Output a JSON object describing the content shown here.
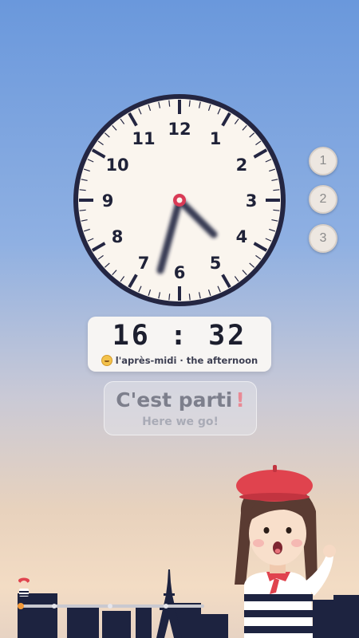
{
  "clock": {
    "numbers": [
      "12",
      "1",
      "2",
      "3",
      "4",
      "5",
      "6",
      "7",
      "8",
      "9",
      "10",
      "11"
    ],
    "shown_time": "16:32",
    "colors": {
      "face": "#faf5ee",
      "rim": "#242642",
      "hand": "#242642",
      "center": "#d93a55"
    }
  },
  "levels": {
    "buttons": [
      {
        "label": "1"
      },
      {
        "label": "2"
      },
      {
        "label": "3"
      }
    ]
  },
  "time_card": {
    "digits": "16 : 32",
    "icon": "smiling-sun-icon",
    "caption": "l'après-midi · the afternoon"
  },
  "go_button": {
    "label": "C'est parti",
    "exclamation": "!",
    "subtitle": "Here we go!"
  },
  "progress": {
    "value": 0.02,
    "markers": 3,
    "colors": {
      "track": "#c9c9d0",
      "fill": "#f39a3a"
    }
  },
  "scene": {
    "character": "french-girl-beret",
    "landmark": "eiffel-tower",
    "colors": {
      "beret": "#e0434e",
      "skyline": "#1d2340"
    }
  }
}
